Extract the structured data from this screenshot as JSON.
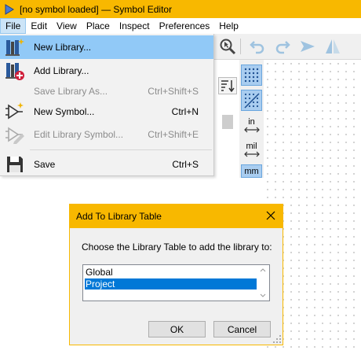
{
  "window": {
    "title": "[no symbol loaded] — Symbol Editor"
  },
  "menubar": [
    "File",
    "Edit",
    "View",
    "Place",
    "Inspect",
    "Preferences",
    "Help"
  ],
  "file_menu": {
    "items": [
      {
        "label": "New Library...",
        "shortcut": "",
        "icon": "new-library-icon",
        "enabled": true,
        "highlighted": true
      },
      {
        "label": "Add Library...",
        "shortcut": "",
        "icon": "add-library-icon",
        "enabled": true
      },
      {
        "label": "Save Library As...",
        "shortcut": "Ctrl+Shift+S",
        "icon": "",
        "enabled": false
      },
      {
        "label": "New Symbol...",
        "shortcut": "Ctrl+N",
        "icon": "new-symbol-icon",
        "enabled": true
      },
      {
        "label": "Edit Library Symbol...",
        "shortcut": "Ctrl+Shift+E",
        "icon": "edit-symbol-icon",
        "enabled": false
      },
      {
        "label": "Save",
        "shortcut": "Ctrl+S",
        "icon": "save-icon",
        "enabled": true
      }
    ]
  },
  "left_toolbar": {
    "units_in": "in",
    "units_mil": "mil",
    "units_mm": "mm"
  },
  "dialog": {
    "title": "Add To Library Table",
    "prompt": "Choose the Library Table to add the library to:",
    "options": [
      "Global",
      "Project"
    ],
    "selected": "Project",
    "ok_label": "OK",
    "cancel_label": "Cancel"
  },
  "colors": {
    "accent": "#f8b800",
    "selection": "#0078d7",
    "menu_highlight": "#91c9f7"
  }
}
